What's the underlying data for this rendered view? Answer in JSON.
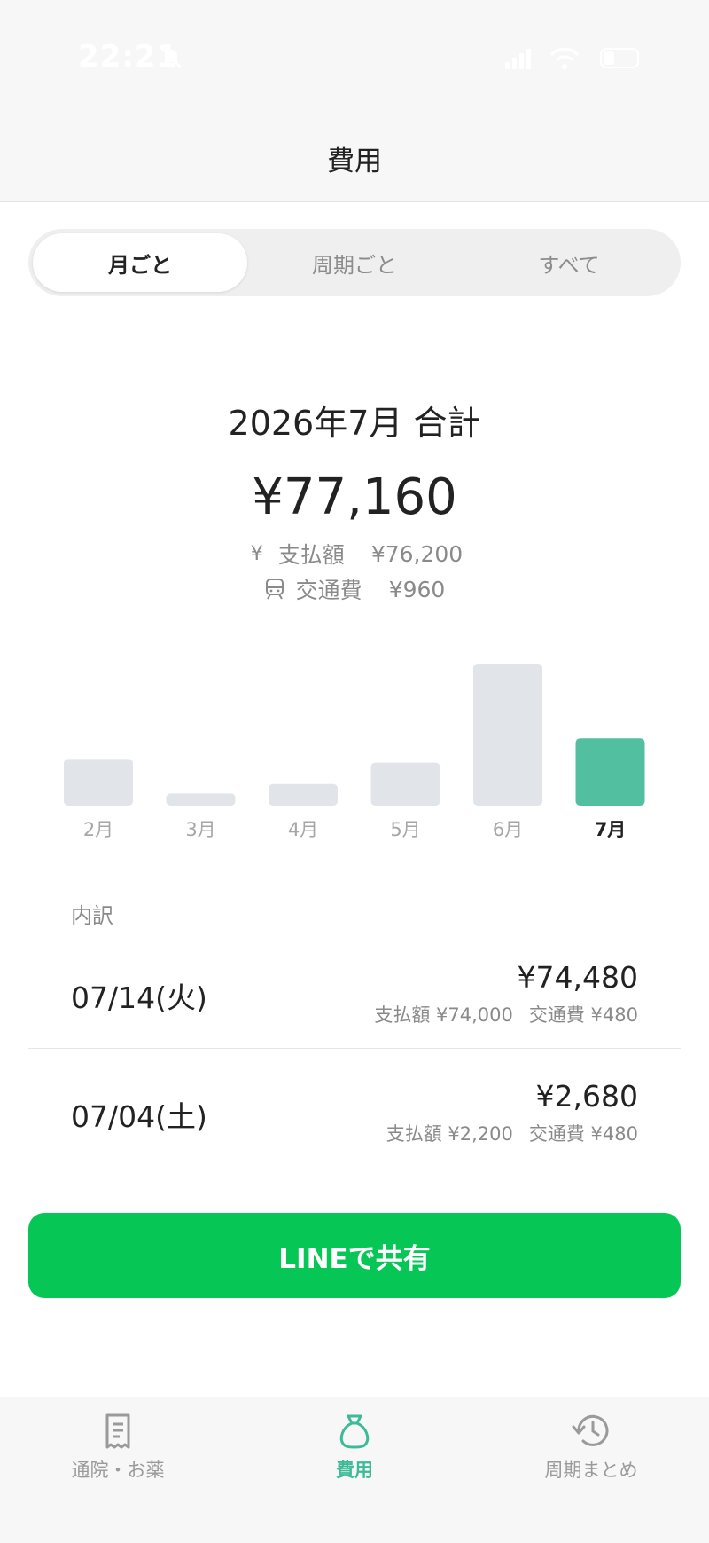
{
  "status_bar": {
    "time": "22:21"
  },
  "header": {
    "title": "費用"
  },
  "segments": [
    "月ごと",
    "周期ごと",
    "すべて"
  ],
  "summary": {
    "title": "2026年7月 合計",
    "total": "¥77,160",
    "payment_label": "支払額",
    "payment_value": "¥76,200",
    "transport_label": "交通費",
    "transport_value": "¥960",
    "yen_glyph": "¥"
  },
  "chart_data": {
    "type": "bar",
    "categories": [
      "2月",
      "3月",
      "4月",
      "5月",
      "6月",
      "7月"
    ],
    "values": [
      25000,
      6500,
      11500,
      23000,
      76000,
      36000
    ],
    "highlighted": "7月",
    "colors": {
      "bar": "#e1e4e8",
      "highlight": "#52bfa1"
    }
  },
  "breakdown": {
    "label": "内訳",
    "rows": [
      {
        "date": "07/14(火)",
        "amount": "¥74,480",
        "payment": "支払額 ¥74,000",
        "transport": "交通費 ¥480"
      },
      {
        "date": "07/04(土)",
        "amount": "¥2,680",
        "payment": "支払額 ¥2,200",
        "transport": "交通費 ¥480"
      }
    ]
  },
  "share_button": {
    "label": "LINEで共有"
  },
  "tabbar": {
    "items": [
      {
        "label": "通院・お薬",
        "icon": "receipt-icon"
      },
      {
        "label": "費用",
        "icon": "money-bag-icon"
      },
      {
        "label": "周期まとめ",
        "icon": "history-icon"
      }
    ]
  },
  "colors": {
    "accent": "#3dbb98",
    "line_green": "#06c755"
  }
}
